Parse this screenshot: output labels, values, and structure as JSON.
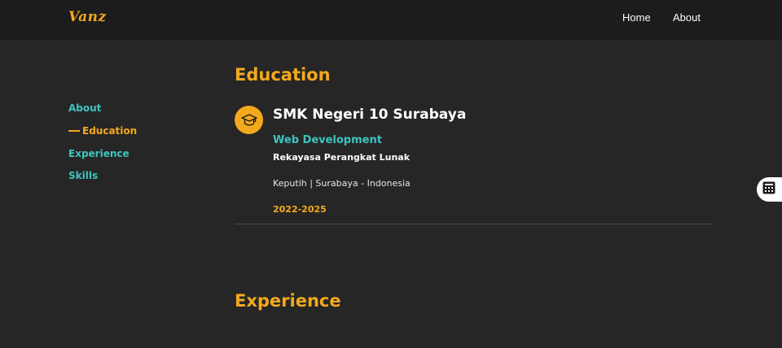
{
  "header": {
    "logo": "Vanz",
    "nav": [
      {
        "label": "Home"
      },
      {
        "label": "About"
      }
    ]
  },
  "sidebar": {
    "items": [
      {
        "label": "About"
      },
      {
        "label": "Education",
        "active": true
      },
      {
        "label": "Experience"
      },
      {
        "label": "Skills"
      }
    ]
  },
  "education": {
    "section_title": "Education",
    "icon": "graduation-cap-icon",
    "school": "SMK Negeri 10 Surabaya",
    "major": "Web Development",
    "program": "Rekayasa Perangkat Lunak",
    "location": "Keputih | Surabaya - Indonesia",
    "years": "2022-2025"
  },
  "experience": {
    "section_title": "Experience"
  },
  "floating_button": {
    "icon": "calculator-icon"
  },
  "colors": {
    "accent": "#f4a91c",
    "teal": "#3ec4c1",
    "background": "#262626",
    "header_background": "#1c1c1c"
  }
}
